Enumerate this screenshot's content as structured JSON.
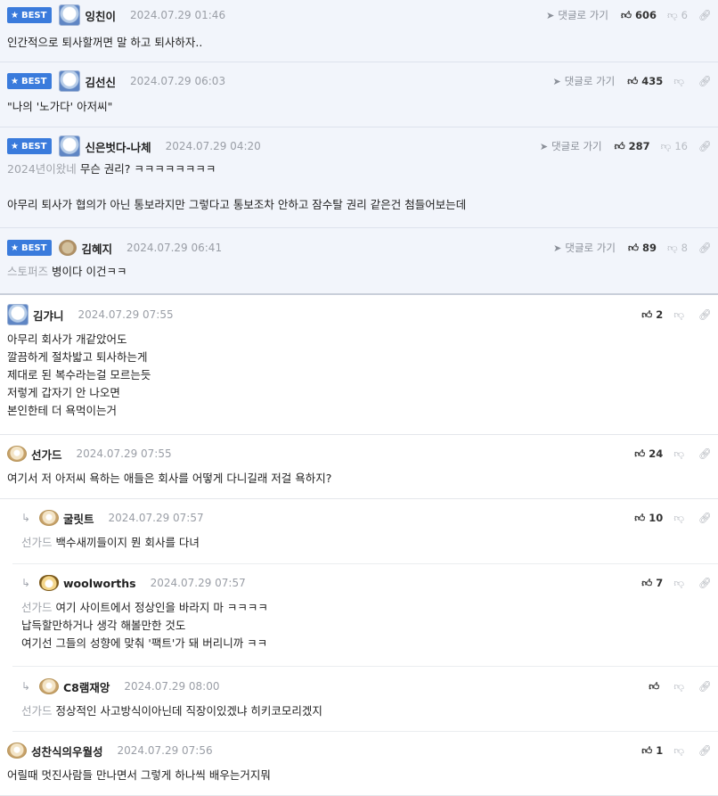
{
  "labels": {
    "best": "BEST",
    "goto_comment": "댓글로 가기"
  },
  "comments": [
    {
      "id": "c1",
      "best": true,
      "avatar": "bear-icon",
      "name": "잉친이",
      "date": "2024.07.29 01:46",
      "upvotes": "606",
      "downvotes": "6",
      "lines": [
        "인간적으로 퇴사할꺼면 말 하고 퇴사하자.."
      ]
    },
    {
      "id": "c2",
      "best": true,
      "avatar": "bear-icon",
      "name": "김선신",
      "date": "2024.07.29 06:03",
      "upvotes": "435",
      "downvotes": "",
      "lines": [
        "\"나의 '노가다' 아저씨\""
      ]
    },
    {
      "id": "c3",
      "best": true,
      "avatar": "bear-icon",
      "name": "신은벗다-나체",
      "date": "2024.07.29 04:20",
      "upvotes": "287",
      "downvotes": "16",
      "mention": "2024년이왔네",
      "lines": [
        "무슨 권리? ㅋㅋㅋㅋㅋㅋㅋㅋ",
        "",
        "아무리 퇴사가 협의가 아닌 통보라지만 그렇다고 통보조차 안하고 잠수탈 권리 같은건 첨들어보는데"
      ]
    },
    {
      "id": "c4",
      "best": true,
      "avatar": "round-icon",
      "name": "김혜지",
      "date": "2024.07.29 06:41",
      "upvotes": "89",
      "downvotes": "8",
      "mention": "스토퍼즈",
      "lines": [
        "병이다 이건ㅋㅋ"
      ]
    },
    {
      "id": "c5",
      "avatar": "bear-icon",
      "name": "김갸니",
      "date": "2024.07.29 07:55",
      "upvotes": "2",
      "lines": [
        "아무리 회사가 개같았어도",
        "깔끔하게 절차밟고 퇴사하는게",
        "제대로 된 복수라는걸 모르는듯",
        "저렇게 갑자기 안 나오면",
        "본인한테 더 욕먹이는거"
      ]
    },
    {
      "id": "c6",
      "avatar": "dog-icon",
      "name": "선가드",
      "date": "2024.07.29 07:55",
      "upvotes": "24",
      "lines": [
        "여기서 저 아저씨 욕하는 애들은 회사를 어떻게 다니길래 저걸 욕하지?"
      ]
    },
    {
      "id": "r1",
      "reply": true,
      "avatar": "dog-icon",
      "name": "굴릿트",
      "date": "2024.07.29 07:57",
      "upvotes": "10",
      "mention": "선가드",
      "lines": [
        "백수새끼들이지 뭔 회사를 다녀"
      ]
    },
    {
      "id": "r2",
      "reply": true,
      "avatar": "cat-icon",
      "name": "woolworths",
      "date": "2024.07.29 07:57",
      "upvotes": "7",
      "mention": "선가드",
      "lines": [
        "여기 사이트에서 정상인을 바라지 마 ㅋㅋㅋㅋ",
        "납득할만하거나 생각 해볼만한 것도",
        "여기선 그들의 성향에 맞춰 '팩트'가 돼 버리니까 ㅋㅋ"
      ]
    },
    {
      "id": "r3",
      "reply": true,
      "avatar": "dog-icon",
      "name": "C8램재앙",
      "date": "2024.07.29 08:00",
      "upvotes": "",
      "mention": "선가드",
      "lines": [
        "정상적인 사고방식이아닌데 직장이있겠냐 히키코모리겠지"
      ]
    },
    {
      "id": "c7",
      "avatar": "dog-icon",
      "name": "성찬식의우월성",
      "date": "2024.07.29 07:56",
      "upvotes": "1",
      "lines": [
        "어릴때 멋진사람들 만나면서 그렇게 하나씩 배우는거지뭐"
      ]
    }
  ]
}
